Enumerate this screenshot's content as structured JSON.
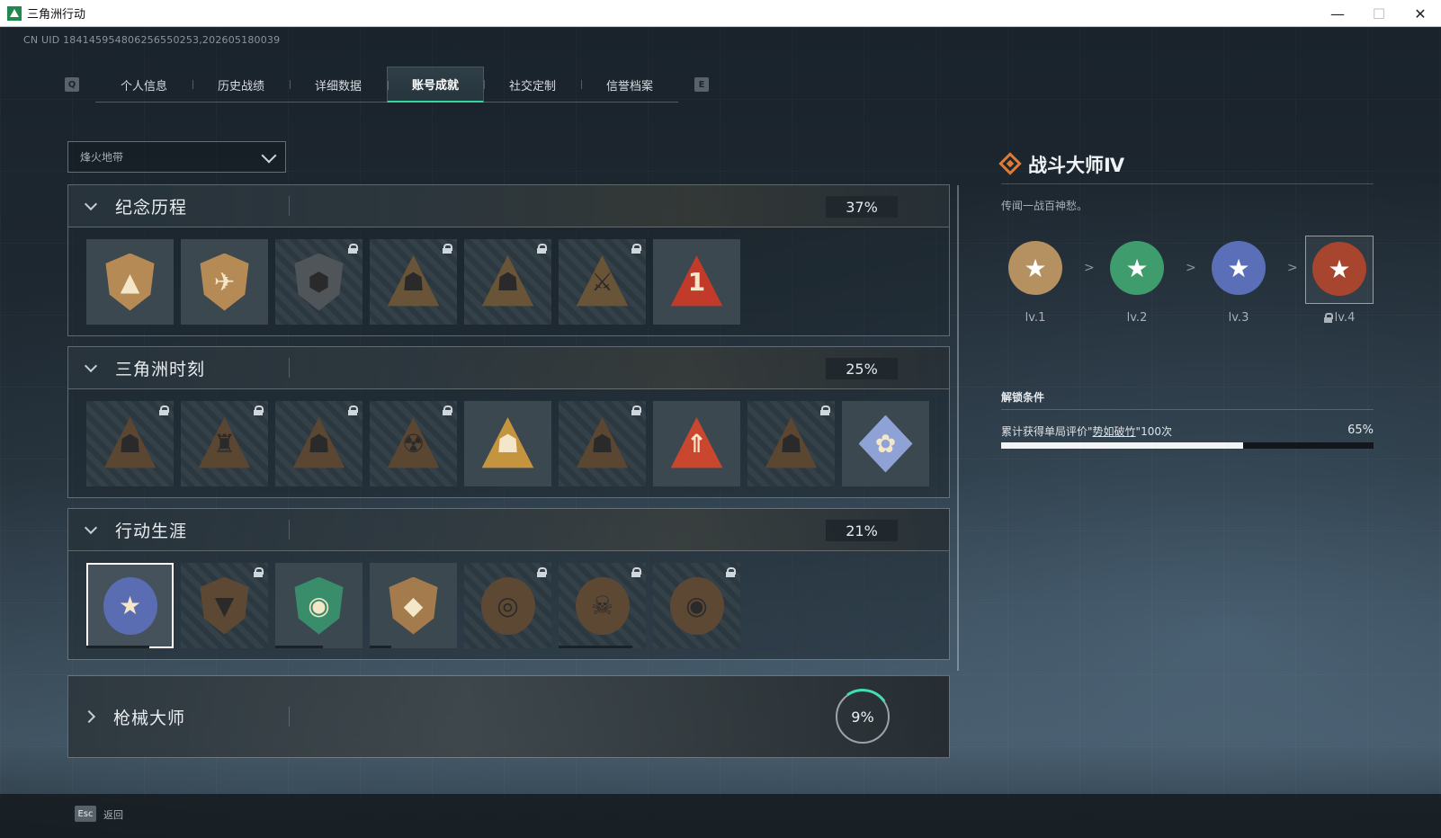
{
  "window": {
    "title": "三角洲行动"
  },
  "uid_text": "CN UID 184145954806256550253,202605180039",
  "tabs": {
    "left_key": "Q",
    "right_key": "E",
    "items": [
      {
        "label": "个人信息"
      },
      {
        "label": "历史战绩"
      },
      {
        "label": "详细数据"
      },
      {
        "label": "账号成就",
        "active": true
      },
      {
        "label": "社交定制"
      },
      {
        "label": "信誉档案"
      }
    ]
  },
  "filter": {
    "selected": "烽火地带"
  },
  "sections": [
    {
      "title": "纪念历程",
      "percent": "37%",
      "badges": [
        {
          "icon": "delta-shield-icon",
          "locked": false,
          "color": "#b58a55"
        },
        {
          "icon": "helicopter-shield-icon",
          "locked": false,
          "color": "#b58a55"
        },
        {
          "icon": "hex-emblem-icon",
          "locked": true,
          "color": "#4f5559"
        },
        {
          "icon": "soldier-triangle-icon",
          "locked": true,
          "color": "#6a5438"
        },
        {
          "icon": "hooded-triangle-icon",
          "locked": true,
          "color": "#6a5438"
        },
        {
          "icon": "crossed-swords-triangle-icon",
          "locked": true,
          "color": "#6a5438"
        },
        {
          "icon": "number-one-triangle-icon",
          "locked": false,
          "color": "#c23a2a"
        }
      ]
    },
    {
      "title": "三角洲时刻",
      "percent": "25%",
      "badges": [
        {
          "icon": "robot-triangle-icon",
          "locked": true,
          "color": "#5b4632"
        },
        {
          "icon": "tower-triangle-icon",
          "locked": true,
          "color": "#5b4632"
        },
        {
          "icon": "diver-triangle-icon",
          "locked": true,
          "color": "#5b4632"
        },
        {
          "icon": "radiation-triangle-icon",
          "locked": true,
          "color": "#5b4632"
        },
        {
          "icon": "squad-triangle-icon",
          "locked": false,
          "color": "#c4953e"
        },
        {
          "icon": "beast-triangle-icon",
          "locked": true,
          "color": "#5b4632"
        },
        {
          "icon": "rocket-triangle-icon",
          "locked": false,
          "color": "#c9462f"
        },
        {
          "icon": "dolphin-triangle-icon",
          "locked": true,
          "color": "#5b4632"
        },
        {
          "icon": "rose-diamond-icon",
          "locked": false,
          "color": "#8fa2d6"
        }
      ]
    },
    {
      "title": "行动生涯",
      "percent": "21%",
      "badges": [
        {
          "icon": "star-medal-icon",
          "locked": false,
          "selected": true,
          "color": "#5a6db3",
          "progress": 0.72
        },
        {
          "icon": "wing-shield-icon",
          "locked": true,
          "color": "#5d4834"
        },
        {
          "icon": "green-shield-icon",
          "locked": false,
          "color": "#3a8d6a",
          "progress": 0.55
        },
        {
          "icon": "crystal-shield-icon",
          "locked": false,
          "color": "#a37b4c",
          "progress": 0.25
        },
        {
          "icon": "spiral-medal-icon",
          "locked": true,
          "color": "#5d4834"
        },
        {
          "icon": "skull-medal-icon",
          "locked": true,
          "color": "#5d4834",
          "progress": 0.85
        },
        {
          "icon": "eye-medal-icon",
          "locked": true,
          "color": "#5d4834"
        }
      ]
    }
  ],
  "gun_section": {
    "title": "枪械大师",
    "percent": "9%"
  },
  "detail": {
    "title": "战斗大师Ⅳ",
    "description": "传闻一战百神愁。",
    "levels": [
      {
        "label": "lv.1",
        "color": "#b59060",
        "locked": false
      },
      {
        "label": "lv.2",
        "color": "#3f9c6c",
        "locked": false
      },
      {
        "label": "lv.3",
        "color": "#5b6fb8",
        "locked": false
      },
      {
        "label": "lv.4",
        "color": "#a8452e",
        "locked": true,
        "selected": true
      }
    ],
    "arrow": ">",
    "unlock_heading": "解锁条件",
    "condition_prefix": "累计获得单局评价\"",
    "condition_highlight": "势如破竹",
    "condition_suffix": "\"100次",
    "condition_percent": "65%",
    "condition_progress": 0.65
  },
  "footer": {
    "key": "Esc",
    "label": "返回"
  }
}
